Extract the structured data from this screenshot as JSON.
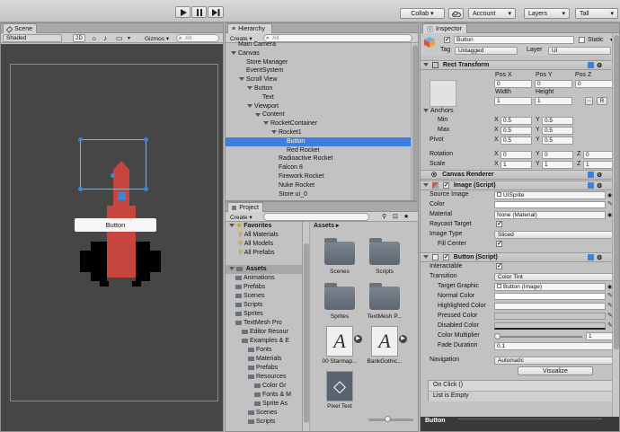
{
  "toolbar": {
    "play_icon": "play-icon",
    "pause_icon": "pause-icon",
    "step_icon": "step-icon",
    "collab_label": "Collab ▾",
    "cloud_icon": "cloud-icon",
    "account_label": "Account",
    "layers_label": "Layers",
    "layout_label": "Tall"
  },
  "scene": {
    "tab_label": "Scene",
    "shading": "Shaded",
    "mode_2d": "2D",
    "gizmos_label": "Gizmos ▾",
    "search_placeholder": "All",
    "button_text": "Button"
  },
  "hierarchy": {
    "tab_label": "Hierarchy",
    "create_label": "Create ▾",
    "search_placeholder": "All",
    "items": [
      {
        "label": "Main Camera",
        "indent": 0,
        "expanded": false,
        "selected": false,
        "has_arrow": false
      },
      {
        "label": "Canvas",
        "indent": 0,
        "expanded": true,
        "selected": false,
        "has_arrow": true
      },
      {
        "label": "Store Manager",
        "indent": 1,
        "expanded": false,
        "selected": false,
        "has_arrow": false
      },
      {
        "label": "EventSystem",
        "indent": 1,
        "expanded": false,
        "selected": false,
        "has_arrow": false
      },
      {
        "label": "Scroll View",
        "indent": 1,
        "expanded": true,
        "selected": false,
        "has_arrow": true
      },
      {
        "label": "Button",
        "indent": 2,
        "expanded": true,
        "selected": false,
        "has_arrow": true
      },
      {
        "label": "Text",
        "indent": 3,
        "expanded": false,
        "selected": false,
        "has_arrow": false
      },
      {
        "label": "Viewport",
        "indent": 2,
        "expanded": true,
        "selected": false,
        "has_arrow": true
      },
      {
        "label": "Content",
        "indent": 3,
        "expanded": true,
        "selected": false,
        "has_arrow": true
      },
      {
        "label": "RocketContainer",
        "indent": 4,
        "expanded": true,
        "selected": false,
        "has_arrow": true
      },
      {
        "label": "Rocket1",
        "indent": 5,
        "expanded": true,
        "selected": false,
        "has_arrow": true
      },
      {
        "label": "Button",
        "indent": 6,
        "expanded": false,
        "selected": true,
        "has_arrow": false
      },
      {
        "label": "Red Rocket",
        "indent": 6,
        "expanded": false,
        "selected": false,
        "has_arrow": false
      },
      {
        "label": "Radioactive Rocket",
        "indent": 5,
        "expanded": false,
        "selected": false,
        "has_arrow": false
      },
      {
        "label": "Falcon 8",
        "indent": 5,
        "expanded": false,
        "selected": false,
        "has_arrow": false
      },
      {
        "label": "Firework Rocket",
        "indent": 5,
        "expanded": false,
        "selected": false,
        "has_arrow": false
      },
      {
        "label": "Nuke Rocket",
        "indent": 5,
        "expanded": false,
        "selected": false,
        "has_arrow": false
      },
      {
        "label": "Store ui_0",
        "indent": 5,
        "expanded": false,
        "selected": false,
        "has_arrow": false
      }
    ]
  },
  "project": {
    "tab_label": "Project",
    "create_label": "Create ▾",
    "favorites_label": "Favorites",
    "favorites": [
      "All Materials",
      "All Models",
      "All Prefabs"
    ],
    "assets_label": "Assets",
    "tree": [
      {
        "label": "Animations",
        "indent": 1
      },
      {
        "label": "Prefabs",
        "indent": 1
      },
      {
        "label": "Scenes",
        "indent": 1
      },
      {
        "label": "Scripts",
        "indent": 1
      },
      {
        "label": "Sprites",
        "indent": 1
      },
      {
        "label": "TextMesh Pro",
        "indent": 1
      },
      {
        "label": "Editor Resour",
        "indent": 2
      },
      {
        "label": "Examples & E",
        "indent": 2
      },
      {
        "label": "Fonts",
        "indent": 3
      },
      {
        "label": "Materials",
        "indent": 3
      },
      {
        "label": "Prefabs",
        "indent": 3
      },
      {
        "label": "Resources",
        "indent": 3
      },
      {
        "label": "Color Gr",
        "indent": 4
      },
      {
        "label": "Fonts & M",
        "indent": 4
      },
      {
        "label": "Sprite As",
        "indent": 4
      },
      {
        "label": "Scenes",
        "indent": 3
      },
      {
        "label": "Scripts",
        "indent": 3
      }
    ],
    "breadcrumb": "Assets ▸",
    "grid": [
      {
        "label": "Scenes",
        "kind": "folder"
      },
      {
        "label": "Scripts",
        "kind": "folder"
      },
      {
        "label": "Sprites",
        "kind": "folder"
      },
      {
        "label": "TextMesh P...",
        "kind": "folder"
      },
      {
        "label": "00 Starmap...",
        "kind": "font"
      },
      {
        "label": "BankGothic...",
        "kind": "font"
      },
      {
        "label": "Pixel Text",
        "kind": "unity"
      }
    ]
  },
  "inspector": {
    "tab_label": "Inspector",
    "object_name": "Button",
    "static_label": "Static",
    "tag_label": "Tag",
    "tag_value": "Untagged",
    "layer_label": "Layer",
    "layer_value": "UI",
    "rect": {
      "title": "Rect Transform",
      "posx_label": "Pos X",
      "posy_label": "Pos Y",
      "posz_label": "Pos Z",
      "posx": "0",
      "posy": "0",
      "posz": "0",
      "width_label": "Width",
      "height_label": "Height",
      "width": "1",
      "height": "1",
      "r_label": "R",
      "anchors_label": "Anchors",
      "min_label": "Min",
      "max_label": "Max",
      "pivot_label": "Pivot",
      "x_label": "X",
      "y_label": "Y",
      "z_label": "Z",
      "min_x": "0.5",
      "min_y": "0.5",
      "max_x": "0.5",
      "max_y": "0.5",
      "pivot_x": "0.5",
      "pivot_y": "0.5",
      "rotation_label": "Rotation",
      "scale_label": "Scale",
      "rot_x": "0",
      "rot_y": "0",
      "rot_z": "0",
      "scale_x": "1",
      "scale_y": "1",
      "scale_z": "1"
    },
    "canvas_renderer": "Canvas Renderer",
    "image": {
      "title": "Image (Script)",
      "source_label": "Source Image",
      "source_value": "UISprite",
      "color_label": "Color",
      "material_label": "Material",
      "material_value": "None (Material)",
      "raycast_label": "Raycast Target",
      "type_label": "Image Type",
      "type_value": "Sliced",
      "fill_label": "Fill Center"
    },
    "button": {
      "title": "Button (Script)",
      "interactable_label": "Interactable",
      "transition_label": "Transition",
      "transition_value": "Color Tint",
      "target_label": "Target Graphic",
      "target_value": "Button (Image)",
      "normal_label": "Normal Color",
      "highlighted_label": "Highlighted Color",
      "pressed_label": "Pressed Color",
      "disabled_label": "Disabled Color",
      "multiplier_label": "Color Multiplier",
      "multiplier_value": "1",
      "fade_label": "Fade Duration",
      "fade_value": "0.1",
      "navigation_label": "Navigation",
      "navigation_value": "Automatic",
      "visualize_label": "Visualize",
      "onclick_label": "On Click ()",
      "list_empty": "List is Empty"
    },
    "footer_label": "Button"
  },
  "colors": {
    "selection": "#3d7ede",
    "rocket_red": "#c8453f",
    "rocket_blue": "#3d86d6",
    "scene_bg": "#464646"
  }
}
